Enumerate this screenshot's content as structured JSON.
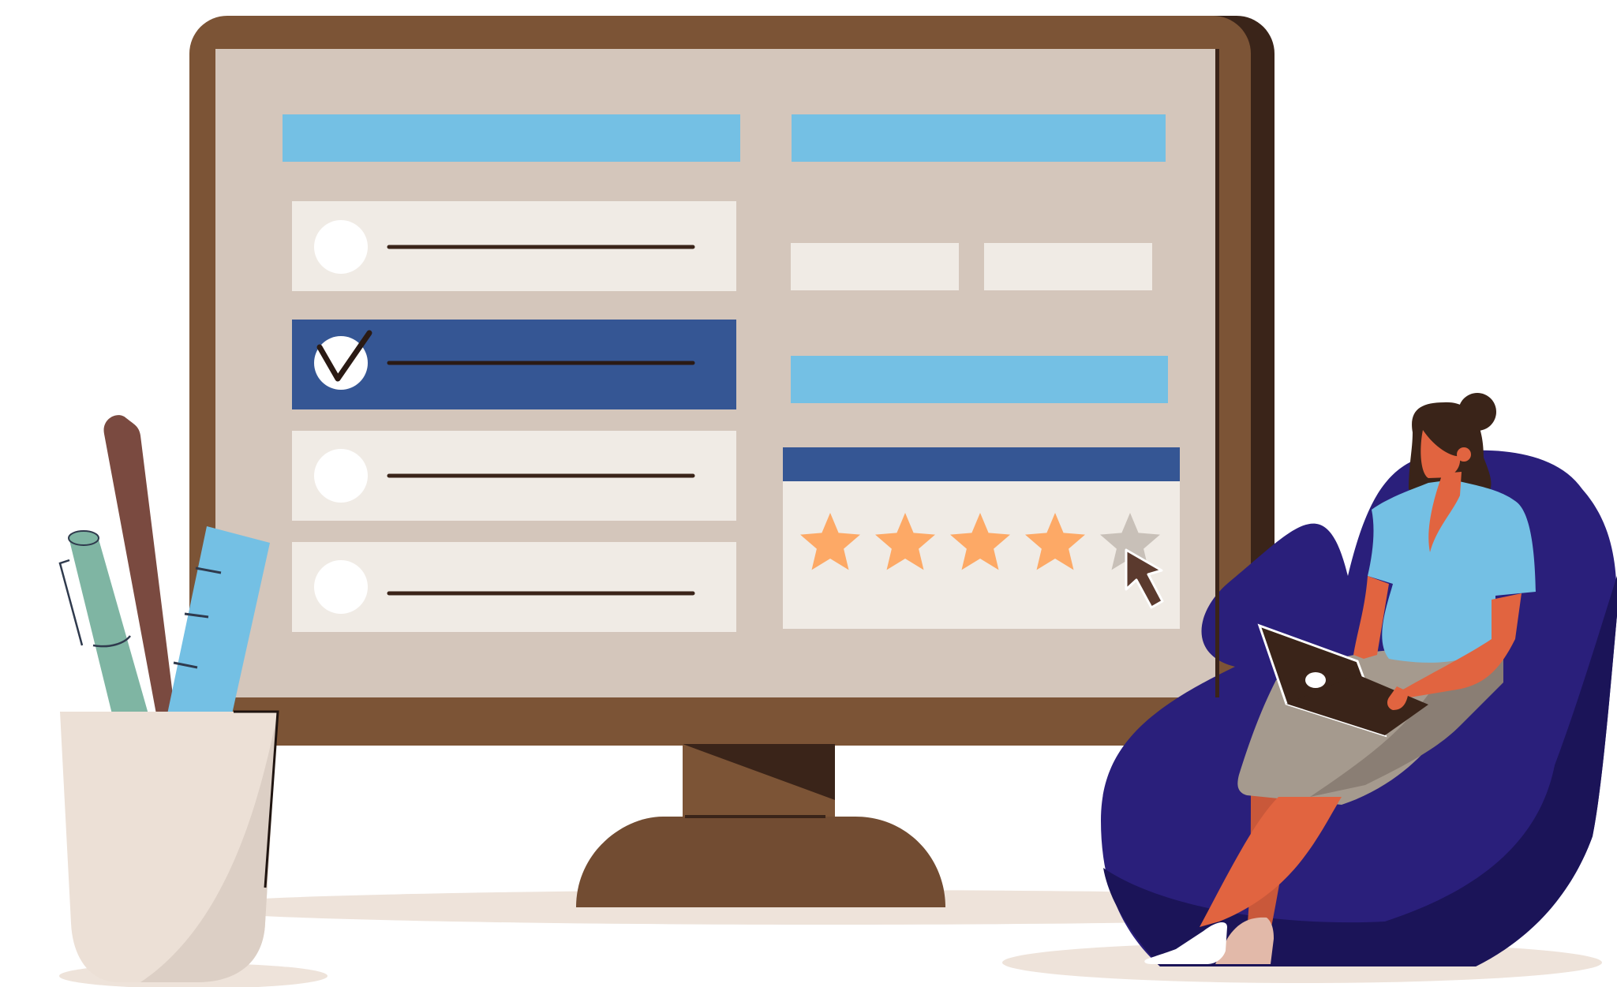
{
  "scene": {
    "background_color": "#ffffff",
    "colors": {
      "monitor_frame": "#7c5436",
      "monitor_shadow": "#3a2419",
      "screen_bg": "#d4c6bb",
      "header_blue": "#74c0e4",
      "option_bg": "#f0ebe5",
      "option_selected_bg": "#355694",
      "rating_header": "#355694",
      "star_filled": "#fda966",
      "star_empty": "#c8c0b8",
      "cursor": "#5b3a2e",
      "beanbag": "#2a1f7b",
      "beanbag_shadow": "#1b1458",
      "shirt": "#74c0e4",
      "skirt": "#a59a8e",
      "skin": "#e16440",
      "hair": "#3a2419",
      "cup": "#ece0d6",
      "pencil": "#7a4a40",
      "pen": "#7fb5a3",
      "ruler": "#74c0e4",
      "floor_shadow": "#eee3da"
    },
    "survey": {
      "option_count": 4,
      "selected_option_index": 1,
      "rating_total": 5,
      "rating_value": 4
    },
    "icons": {
      "check": "checkmark-icon",
      "star": "star-icon",
      "cursor": "mouse-pointer-icon",
      "laptop_logo": "laptop-logo-icon"
    }
  }
}
